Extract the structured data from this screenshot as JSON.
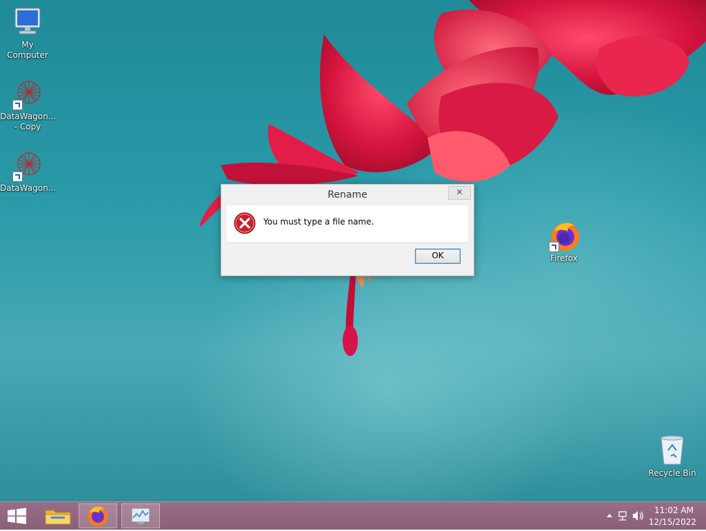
{
  "desktop": {
    "icons": [
      {
        "label": "My Computer",
        "icon": "computer-icon"
      },
      {
        "label": "DataWagon... - Copy",
        "icon": "datawagon-icon"
      },
      {
        "label": "DataWagon...",
        "icon": "datawagon-icon"
      },
      {
        "label": "Firefox",
        "icon": "firefox-icon"
      },
      {
        "label": "Recycle Bin",
        "icon": "recycle-bin-icon"
      }
    ]
  },
  "dialog": {
    "title": "Rename",
    "close_glyph": "✕",
    "message": "You must type a file name.",
    "ok_label": "OK",
    "icon": "error-icon"
  },
  "taskbar": {
    "buttons": [
      {
        "name": "start",
        "icon": "windows-logo-icon"
      },
      {
        "name": "file-explorer",
        "icon": "folder-icon"
      },
      {
        "name": "firefox",
        "icon": "firefox-icon",
        "active": true
      },
      {
        "name": "resource-monitor",
        "icon": "monitor-icon"
      }
    ],
    "tray": {
      "time": "11:02 AM",
      "date": "12/15/2022"
    }
  },
  "colors": {
    "desktop_teal": "#2a9aa8",
    "taskbar": "#8a5f78",
    "error_red": "#c8202a",
    "button_border": "#3c7fb1"
  }
}
